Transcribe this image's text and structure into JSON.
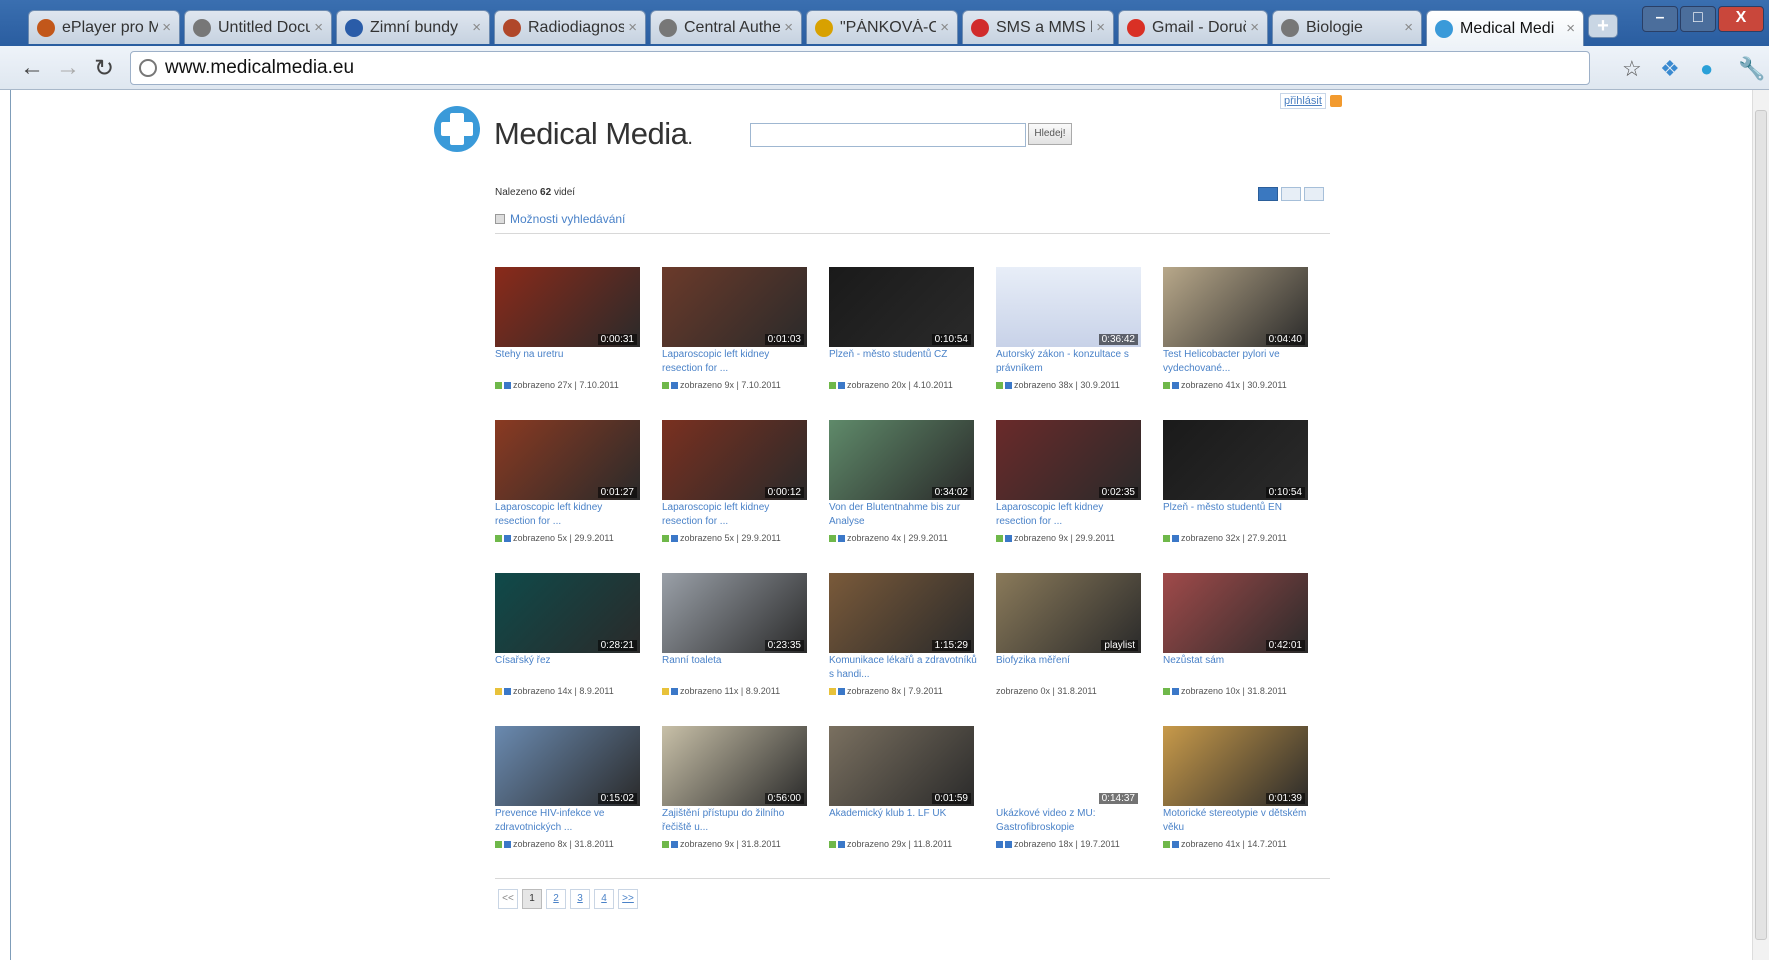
{
  "browser": {
    "tabs": [
      {
        "label": "ePlayer pro M",
        "icon": "house-icon",
        "color": "#c2571a"
      },
      {
        "label": "Untitled Docu",
        "icon": "globe-icon",
        "color": "#777777"
      },
      {
        "label": "Zimní bundy",
        "icon": "y-logo-icon",
        "color": "#2a5ca8"
      },
      {
        "label": "Radiodiagnos",
        "icon": "radio-icon",
        "color": "#b0472a"
      },
      {
        "label": "Central Authe",
        "icon": "globe-icon",
        "color": "#777777"
      },
      {
        "label": "\"PÁNKOVÁ-C",
        "icon": "lambda-icon",
        "color": "#d8a100"
      },
      {
        "label": "SMS a MMS b",
        "icon": "drop-icon",
        "color": "#d12b2b"
      },
      {
        "label": "Gmail - Doruč",
        "icon": "mail-icon",
        "color": "#d93025"
      },
      {
        "label": "Biologie",
        "icon": "globe-icon",
        "color": "#777777"
      },
      {
        "label": "Medical Medi",
        "icon": "cross-icon",
        "color": "#3a9ad9"
      }
    ],
    "new_tab": "+",
    "url": "www.medicalmedia.eu",
    "win_min": "–",
    "win_max": "□",
    "win_close": "X"
  },
  "site": {
    "login": "přihlásit",
    "logo_text": "Medical Media",
    "logo_dot": ".",
    "search_button": "Hledej!",
    "found_prefix": "Nalezeno",
    "found_count": "62",
    "found_suffix": "videí",
    "search_options": "Možnosti vyhledávání"
  },
  "videos": [
    {
      "title": "Stehy na uretru",
      "duration": "0:00:31",
      "meta": "zobrazeno 27x | 7.10.2011",
      "thumb": "#8a2a1a",
      "badge": [
        "g",
        "b"
      ]
    },
    {
      "title": "Laparoscopic left kidney resection for ...",
      "duration": "0:01:03",
      "meta": "zobrazeno 9x | 7.10.2011",
      "thumb": "#6b3a2a",
      "badge": [
        "g",
        "b"
      ]
    },
    {
      "title": "Plzeň - město studentů CZ",
      "duration": "0:10:54",
      "meta": "zobrazeno 20x | 4.10.2011",
      "thumb": "#1a1a1a",
      "badge": [
        "g",
        "b"
      ]
    },
    {
      "title": "Autorský zákon - konzultace s právníkem",
      "duration": "0:36:42",
      "meta": "zobrazeno 38x | 30.9.2011",
      "thumb": "#c8d2e8",
      "badge": [
        "g",
        "b"
      ]
    },
    {
      "title": "Test Helicobacter pylori ve vydechované...",
      "duration": "0:04:40",
      "meta": "zobrazeno 41x | 30.9.2011",
      "thumb": "#b8a88a",
      "badge": [
        "g",
        "b"
      ]
    },
    {
      "title": "Laparoscopic left kidney resection for ...",
      "duration": "0:01:27",
      "meta": "zobrazeno 5x | 29.9.2011",
      "thumb": "#8a3a22",
      "badge": [
        "g",
        "b"
      ]
    },
    {
      "title": "Laparoscopic left kidney resection for ...",
      "duration": "0:00:12",
      "meta": "zobrazeno 5x | 29.9.2011",
      "thumb": "#7a3020",
      "badge": [
        "g",
        "b"
      ]
    },
    {
      "title": "Von der Blutentnahme bis zur Analyse",
      "duration": "0:34:02",
      "meta": "zobrazeno 4x | 29.9.2011",
      "thumb": "#5f8a6a",
      "badge": [
        "g",
        "b"
      ]
    },
    {
      "title": "Laparoscopic left kidney resection for ...",
      "duration": "0:02:35",
      "meta": "zobrazeno 9x | 29.9.2011",
      "thumb": "#6a2a2a",
      "badge": [
        "g",
        "b"
      ]
    },
    {
      "title": "Plzeň - město studentů EN",
      "duration": "0:10:54",
      "meta": "zobrazeno 32x | 27.9.2011",
      "thumb": "#1a1a1a",
      "badge": [
        "g",
        "b"
      ]
    },
    {
      "title": "Císařský řez",
      "duration": "0:28:21",
      "meta": "zobrazeno 14x | 8.9.2011",
      "thumb": "#0f4a4a",
      "badge": [
        "y",
        "b"
      ]
    },
    {
      "title": "Ranní toaleta",
      "duration": "0:23:35",
      "meta": "zobrazeno 11x | 8.9.2011",
      "thumb": "#9aa0a8",
      "badge": [
        "y",
        "b"
      ]
    },
    {
      "title": "Komunikace lékařů a zdravotníků s handi...",
      "duration": "1:15:29",
      "meta": "zobrazeno 8x | 7.9.2011",
      "thumb": "#7a5a3a",
      "badge": [
        "y",
        "b"
      ]
    },
    {
      "title": "Biofyzika měření",
      "duration": "playlist",
      "meta": "zobrazeno 0x | 31.8.2011",
      "thumb": "#8a7a5a",
      "badge": []
    },
    {
      "title": "Nezůstat sám",
      "duration": "0:42:01",
      "meta": "zobrazeno 10x | 31.8.2011",
      "thumb": "#a04a4a",
      "badge": [
        "g",
        "b"
      ]
    },
    {
      "title": "Prevence HIV-infekce ve zdravotnických ...",
      "duration": "0:15:02",
      "meta": "zobrazeno 8x | 31.8.2011",
      "thumb": "#6a8ab0",
      "badge": [
        "g",
        "b"
      ]
    },
    {
      "title": "Zajištění přístupu do žilního řečiště u...",
      "duration": "0:56:00",
      "meta": "zobrazeno 9x | 31.8.2011",
      "thumb": "#c8c0a8",
      "badge": [
        "g",
        "b"
      ]
    },
    {
      "title": "Akademický klub 1. LF UK",
      "duration": "0:01:59",
      "meta": "zobrazeno 29x | 11.8.2011",
      "thumb": "#7a7060",
      "badge": [
        "g",
        "b"
      ]
    },
    {
      "title": "Ukázkové video z MU: Gastrofibroskopie",
      "duration": "0:14:37",
      "meta": "zobrazeno 18x | 19.7.2011",
      "thumb": "#ffffff",
      "badge": [
        "b",
        "b"
      ]
    },
    {
      "title": "Motorické stereotypie v dětském věku",
      "duration": "0:01:39",
      "meta": "zobrazeno 41x | 14.7.2011",
      "thumb": "#c89a4a",
      "badge": [
        "g",
        "b"
      ]
    }
  ],
  "pagination": {
    "first": "<<",
    "pages": [
      "1",
      "2",
      "3",
      "4"
    ],
    "last": ">>"
  }
}
